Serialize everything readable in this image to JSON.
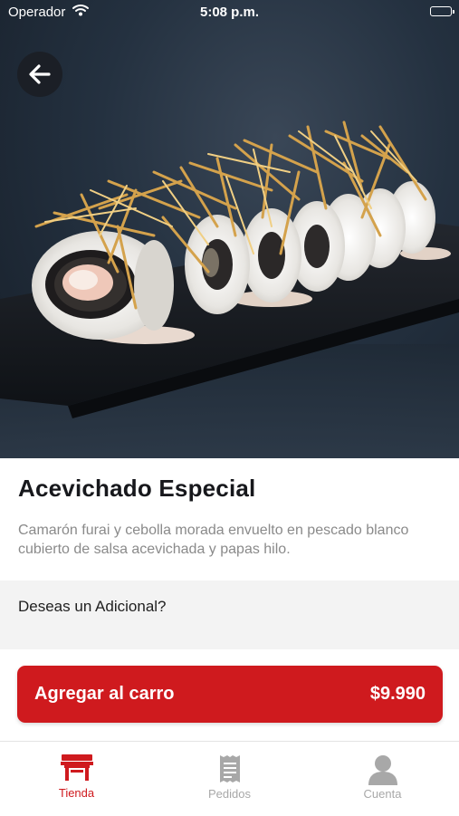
{
  "status_bar": {
    "carrier": "Operador",
    "time": "5:08 p.m."
  },
  "product": {
    "title": "Acevichado Especial",
    "description": "Camarón furai y cebolla morada envuelto en pescado blanco cubierto de salsa acevichada y papas hilo.",
    "addon_prompt": "Deseas un Adicional?"
  },
  "cart": {
    "label": "Agregar al carro",
    "price": "$9.990"
  },
  "tabs": [
    {
      "label": "Tienda",
      "icon": "store-icon",
      "active": true
    },
    {
      "label": "Pedidos",
      "icon": "receipt-icon",
      "active": false
    },
    {
      "label": "Cuenta",
      "icon": "user-icon",
      "active": false
    }
  ],
  "colors": {
    "accent": "#cf1a1e",
    "inactive_tab": "#a8a8a8",
    "title": "#17181c",
    "description": "#8a8a8a",
    "addon_background": "#f3f3f3"
  }
}
